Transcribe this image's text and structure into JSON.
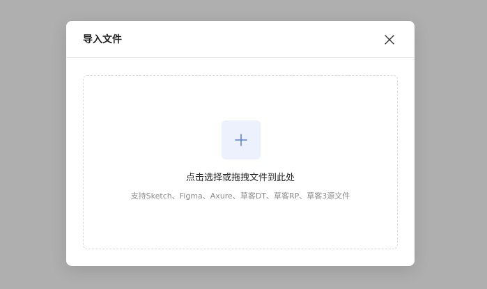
{
  "modal": {
    "title": "导入文件",
    "close_icon": "close-icon"
  },
  "dropzone": {
    "icon": "plus-icon",
    "primary_text": "点击选择或拖拽文件到此处",
    "secondary_text": "支持Sketch、Figma、Axure、草客DT、草客RP、草客3源文件"
  },
  "colors": {
    "overlay": "#afafaf",
    "accent": "#5b7be0",
    "tile_bg": "#edf1fd",
    "border": "#dcdcdc"
  }
}
